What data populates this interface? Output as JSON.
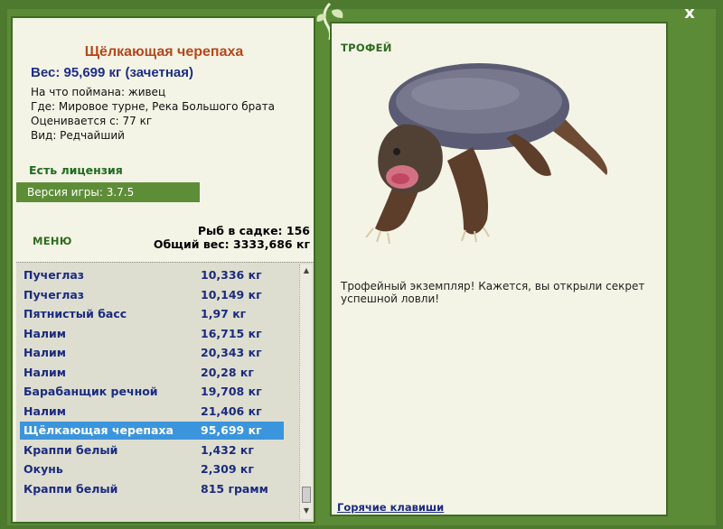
{
  "fish": {
    "title": "Щёлкающая черепаха",
    "weight_line": "Вес: 95,699 кг (зачетная)",
    "info": [
      "На что поймана: живец",
      "Где: Мировое турне, Река Большого брата",
      "Оценивается с: 77 кг",
      "Вид: Редчайший"
    ]
  },
  "license": "Есть лицензия",
  "version": "Версия игры: 3.7.5",
  "menu_label": "МЕНЮ",
  "stats": {
    "in_keepnet": "Рыб в садке: 156",
    "total_weight": "Общий вес: 3333,686 кг"
  },
  "catch_list": [
    {
      "name": "Пучеглаз",
      "weight": "10,336 кг"
    },
    {
      "name": "Пучеглаз",
      "weight": "10,149 кг"
    },
    {
      "name": "Пятнистый басс",
      "weight": "1,97 кг"
    },
    {
      "name": "Налим",
      "weight": "16,715 кг"
    },
    {
      "name": "Налим",
      "weight": "20,343 кг"
    },
    {
      "name": "Налим",
      "weight": "20,28 кг"
    },
    {
      "name": "Барабанщик речной",
      "weight": "19,708 кг"
    },
    {
      "name": "Налим",
      "weight": "21,406 кг"
    },
    {
      "name": "Щёлкающая черепаха",
      "weight": "95,699 кг"
    },
    {
      "name": "Краппи белый",
      "weight": "1,432 кг"
    },
    {
      "name": "Окунь",
      "weight": "2,309 кг"
    },
    {
      "name": "Краппи белый",
      "weight": "815 грамм"
    }
  ],
  "selected_index": 8,
  "trophy": {
    "label": "ТРОФЕЙ",
    "description": "Трофейный экземпляр! Кажется, вы открыли секрет успешной ловли!"
  },
  "hotkeys": "Горячие клавиши",
  "close_glyph": "x",
  "colors": {
    "frame": "#5b8b36",
    "panel": "#f4f4e6",
    "title": "#b8471b",
    "weight": "#1d2e85",
    "license": "#1e6b1e",
    "selected": "#3b95dc"
  }
}
